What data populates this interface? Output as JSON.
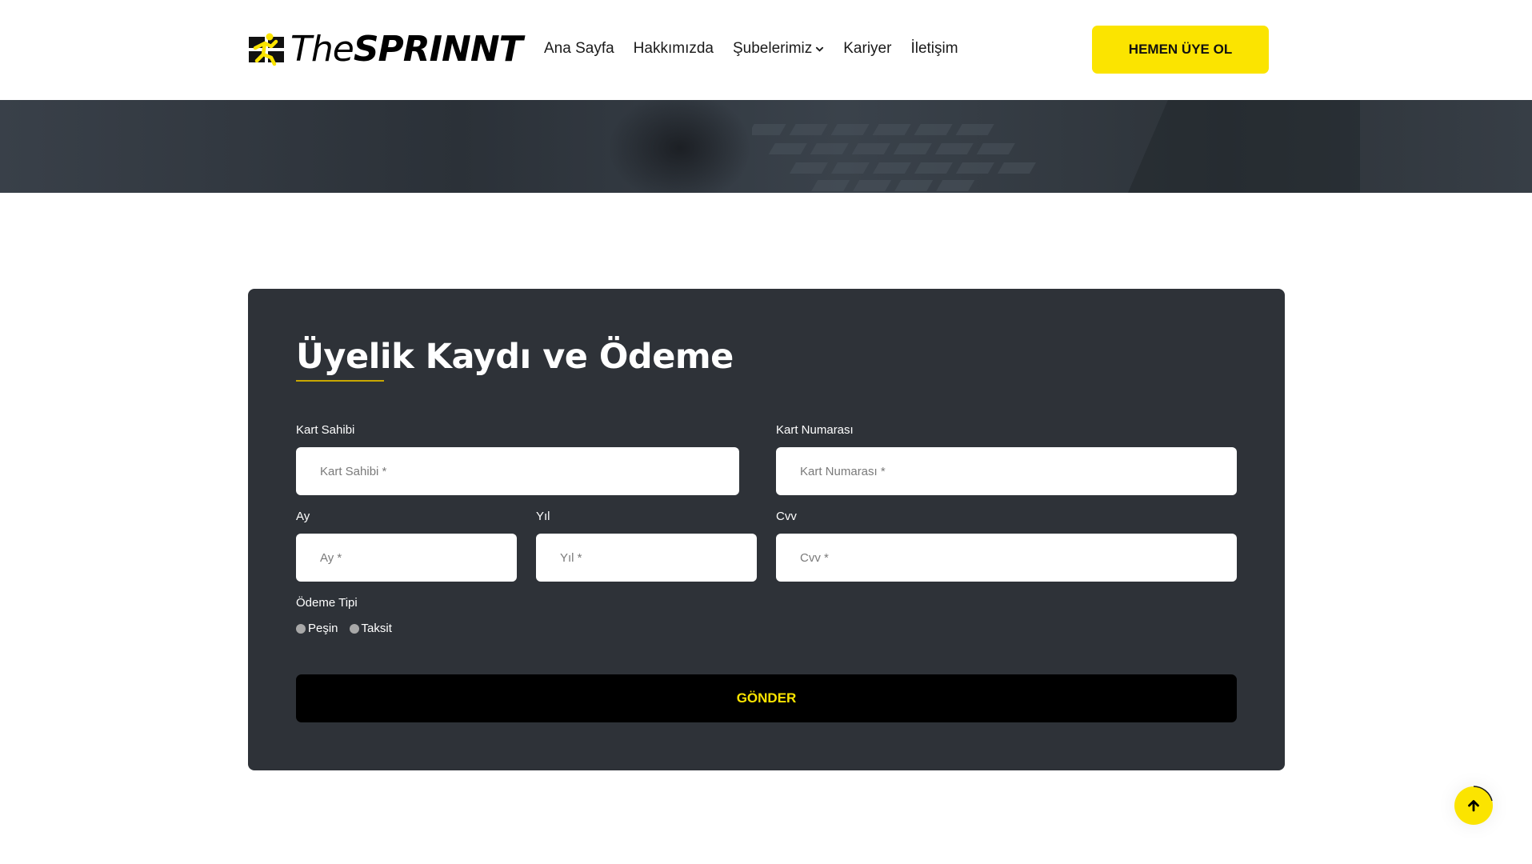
{
  "header": {
    "logo": {
      "the": "The",
      "brand": "SPRINNT"
    },
    "nav": [
      {
        "label": "Ana Sayfa"
      },
      {
        "label": "Hakkımızda"
      },
      {
        "label": "Şubelerimiz",
        "dropdown": true
      },
      {
        "label": "Kariyer"
      },
      {
        "label": "İletişim"
      }
    ],
    "cta_label": "HEMEN ÜYE OL"
  },
  "form": {
    "title": "Üyelik Kaydı ve Ödeme",
    "fields": {
      "card_holder": {
        "label": "Kart Sahibi",
        "placeholder": "Kart Sahibi *",
        "value": ""
      },
      "card_number": {
        "label": "Kart Numarası",
        "placeholder": "Kart Numarası *",
        "value": ""
      },
      "month": {
        "label": "Ay",
        "placeholder": "Ay *",
        "value": ""
      },
      "year": {
        "label": "Yıl",
        "placeholder": "Yıl *",
        "value": ""
      },
      "cvv": {
        "label": "Cvv",
        "placeholder": "Cvv *",
        "value": ""
      }
    },
    "payment_type": {
      "label": "Ödeme Tipi",
      "options": [
        {
          "label": "Peşin",
          "selected": false
        },
        {
          "label": "Taksit",
          "selected": false
        }
      ]
    },
    "submit_label": "GÖNDER"
  },
  "colors": {
    "accent": "#fbe400",
    "card_bg": "#2e3238",
    "header_bg": "#ffffff",
    "button_dark": "#000000"
  },
  "icons": {
    "logo_mark": "runner-logo-icon",
    "dropdown": "chevron-down-icon",
    "back_to_top": "arrow-up-icon"
  }
}
